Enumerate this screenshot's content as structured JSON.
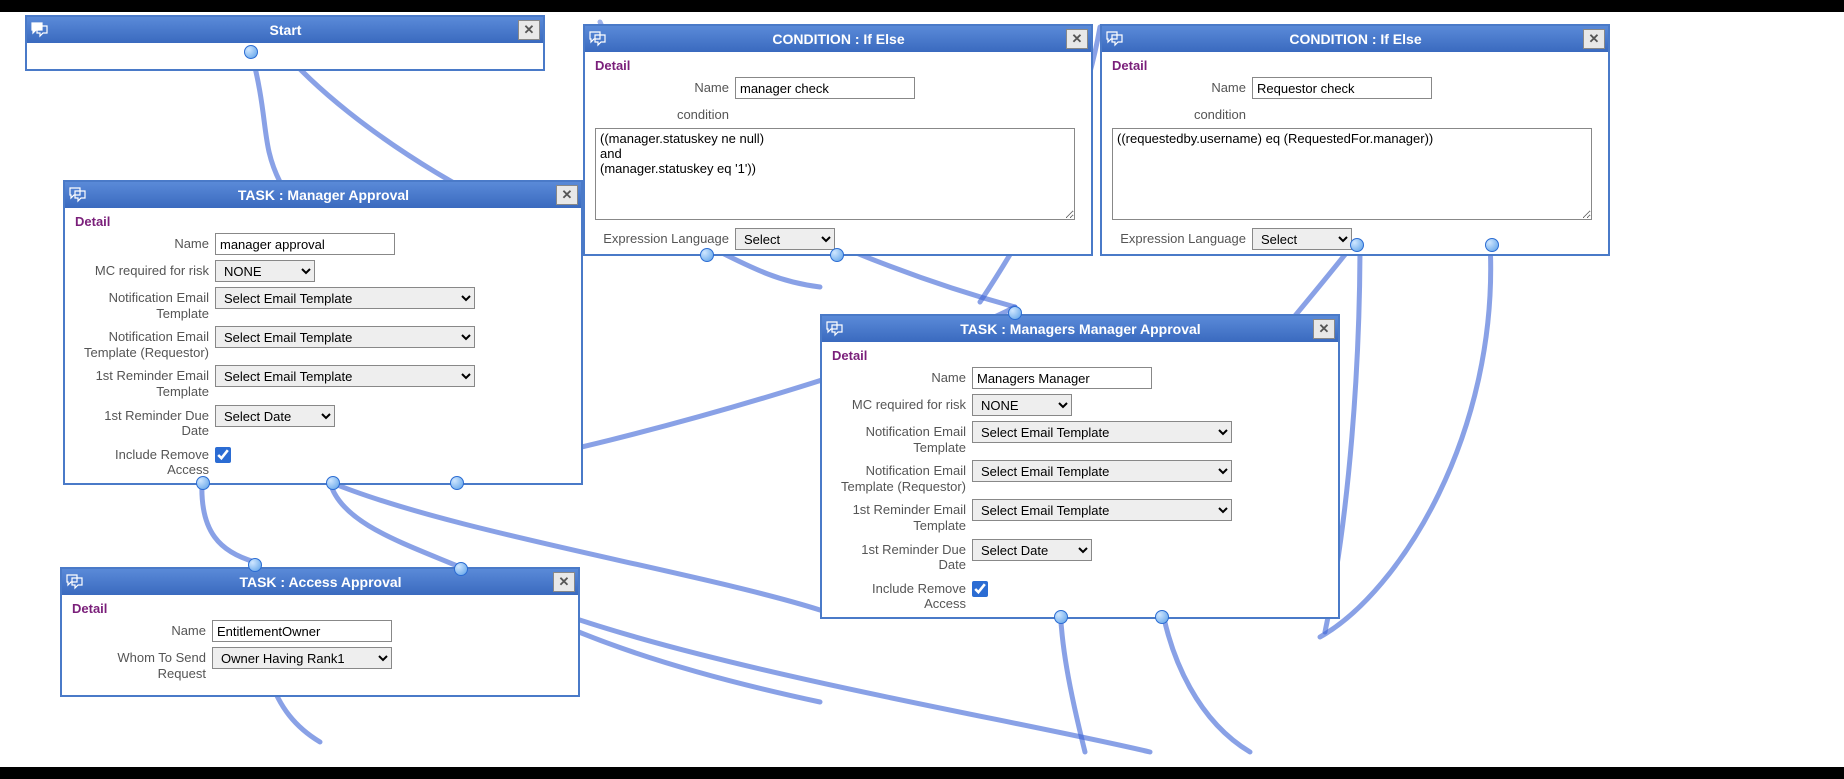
{
  "nodes": {
    "start": {
      "title": "Start"
    },
    "cond1": {
      "title": "CONDITION : If Else",
      "detail": "Detail",
      "name_label": "Name",
      "name_value": "manager check",
      "condition_label": "condition",
      "condition_value": "((manager.statuskey ne null)\nand\n(manager.statuskey eq '1'))",
      "expr_label": "Expression Language",
      "expr_select": "Select"
    },
    "cond2": {
      "title": "CONDITION : If Else",
      "detail": "Detail",
      "name_label": "Name",
      "name_value": "Requestor check",
      "condition_label": "condition",
      "condition_value": "((requestedby.username) eq (RequestedFor.manager))",
      "expr_label": "Expression Language",
      "expr_select": "Select"
    },
    "task1": {
      "title": "TASK : Manager Approval",
      "detail": "Detail",
      "name_label": "Name",
      "name_value": "manager approval",
      "mc_label": "MC required for risk",
      "mc_value": "NONE",
      "net_label": "Notification Email Template",
      "net_value": "Select Email Template",
      "netr_label": "Notification Email Template (Requestor)",
      "netr_value": "Select Email Template",
      "ret_label": "1st Reminder Email Template",
      "ret_value": "Select Email Template",
      "rdd_label": "1st Reminder Due Date",
      "rdd_value": "Select Date",
      "ira_label": "Include Remove Access"
    },
    "task2": {
      "title": "TASK : Managers Manager Approval",
      "detail": "Detail",
      "name_label": "Name",
      "name_value": "Managers Manager",
      "mc_label": "MC required for risk",
      "mc_value": "NONE",
      "net_label": "Notification Email Template",
      "net_value": "Select Email Template",
      "netr_label": "Notification Email Template (Requestor)",
      "netr_value": "Select Email Template",
      "ret_label": "1st Reminder Email Template",
      "ret_value": "Select Email Template",
      "rdd_label": "1st Reminder Due Date",
      "rdd_value": "Select Date",
      "ira_label": "Include Remove Access"
    },
    "task3": {
      "title": "TASK : Access Approval",
      "detail": "Detail",
      "name_label": "Name",
      "name_value": "EntitlementOwner",
      "wts_label": "Whom To Send Request",
      "wts_value": "Owner Having Rank1"
    }
  }
}
